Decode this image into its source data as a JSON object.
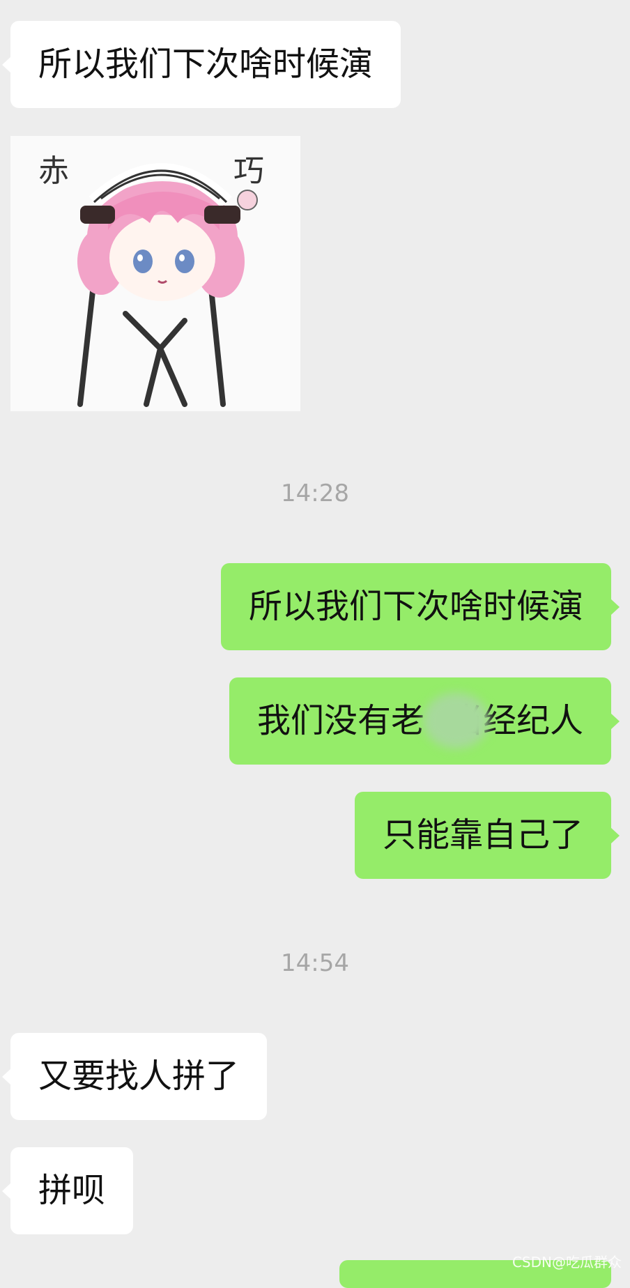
{
  "messages": [
    {
      "side": "in",
      "text": "所以我们下次啥时候演"
    },
    {
      "side": "in",
      "type": "sticker",
      "caption_left": "赤",
      "caption_right": "巧"
    },
    {
      "side": "out",
      "text": "所以我们下次啥时候演"
    },
    {
      "side": "out",
      "text_before": "我们没有老",
      "text_after": "当经纪人"
    },
    {
      "side": "out",
      "text": "只能靠自己了"
    },
    {
      "side": "in",
      "text": "又要找人拼了"
    },
    {
      "side": "in",
      "text": "拼呗"
    }
  ],
  "timestamps": [
    "14:28",
    "14:54"
  ],
  "watermark": "CSDN@吃瓜群众",
  "colors": {
    "background": "#ededed",
    "incoming_bubble": "#ffffff",
    "outgoing_bubble": "#95ec69",
    "timestamp": "#a6a6a6"
  }
}
